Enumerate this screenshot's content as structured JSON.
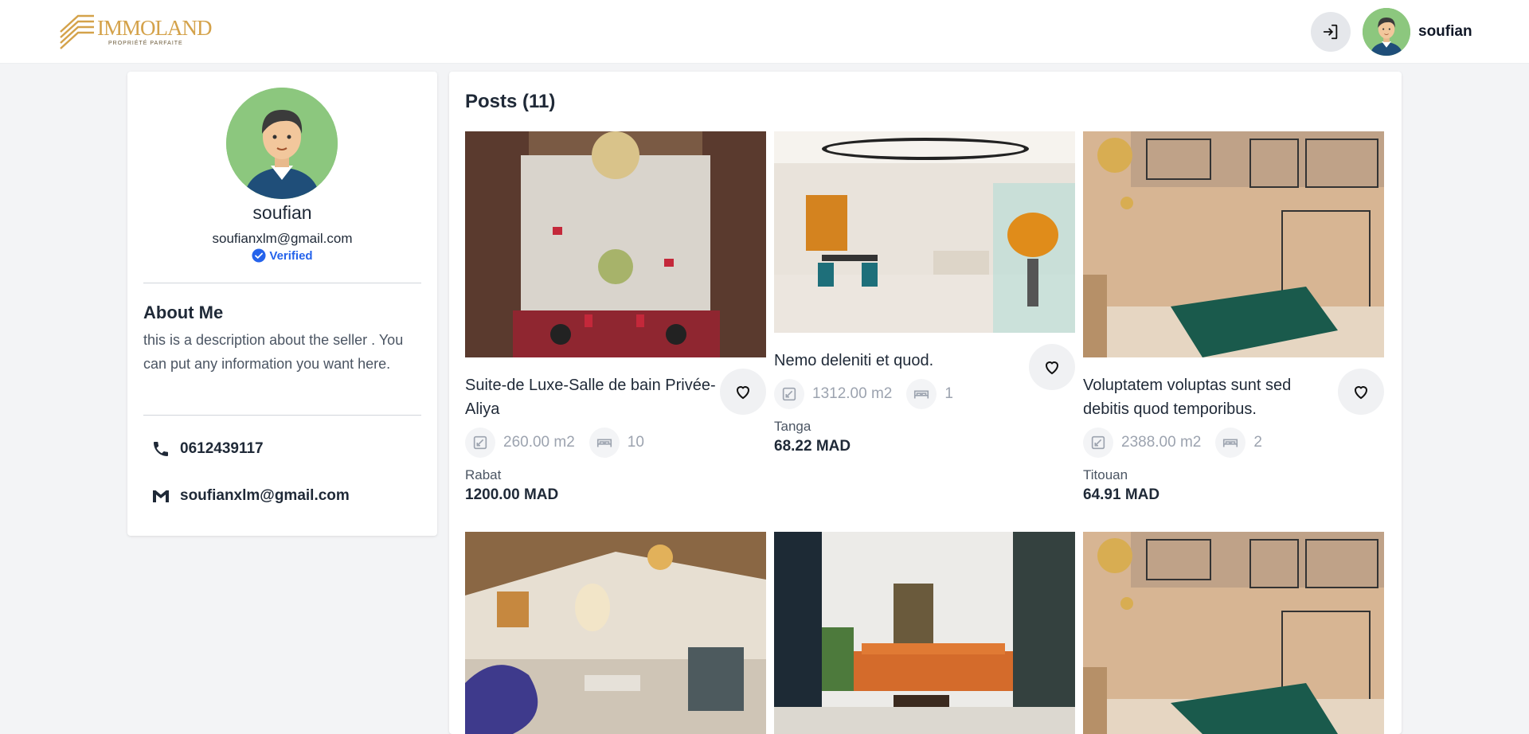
{
  "app": {
    "logo_name": "IMMOLAND",
    "logo_tagline": "PROPRIÉTÉ PARFAITE",
    "user_name": "soufian",
    "logout_icon": "logout-icon"
  },
  "profile": {
    "name": "soufian",
    "email": "soufianxlm@gmail.com",
    "verified_label": "Verified",
    "about_title": "About Me",
    "about_text": "this is a description about the seller . You can put any information you want here.",
    "phone": "0612439117",
    "contact_email": "soufianxlm@gmail.com"
  },
  "posts": {
    "title": "Posts (11)",
    "items": [
      {
        "title": "Suite-de Luxe-Salle de bain Privée-Aliya",
        "area": "260.00 m2",
        "beds": "10",
        "city": "Rabat",
        "price": "1200.00 MAD"
      },
      {
        "title": "Nemo deleniti et quod.",
        "area": "1312.00 m2",
        "beds": "1",
        "city": "Tanga",
        "price": "68.22 MAD"
      },
      {
        "title": "Voluptatem voluptas sunt sed debitis quod temporibus.",
        "area": "2388.00 m2",
        "beds": "2",
        "city": "Titouan",
        "price": "64.91 MAD"
      },
      {
        "title": "",
        "area": "",
        "beds": "",
        "city": "",
        "price": ""
      },
      {
        "title": "",
        "area": "",
        "beds": "",
        "city": "",
        "price": ""
      },
      {
        "title": "",
        "area": "",
        "beds": "",
        "city": "",
        "price": ""
      }
    ]
  },
  "colors": {
    "brand_gold": "#d4a24a",
    "verified_blue": "#2563eb",
    "avatar_bg": "#8cc77e",
    "page_bg": "#f3f4f6"
  }
}
